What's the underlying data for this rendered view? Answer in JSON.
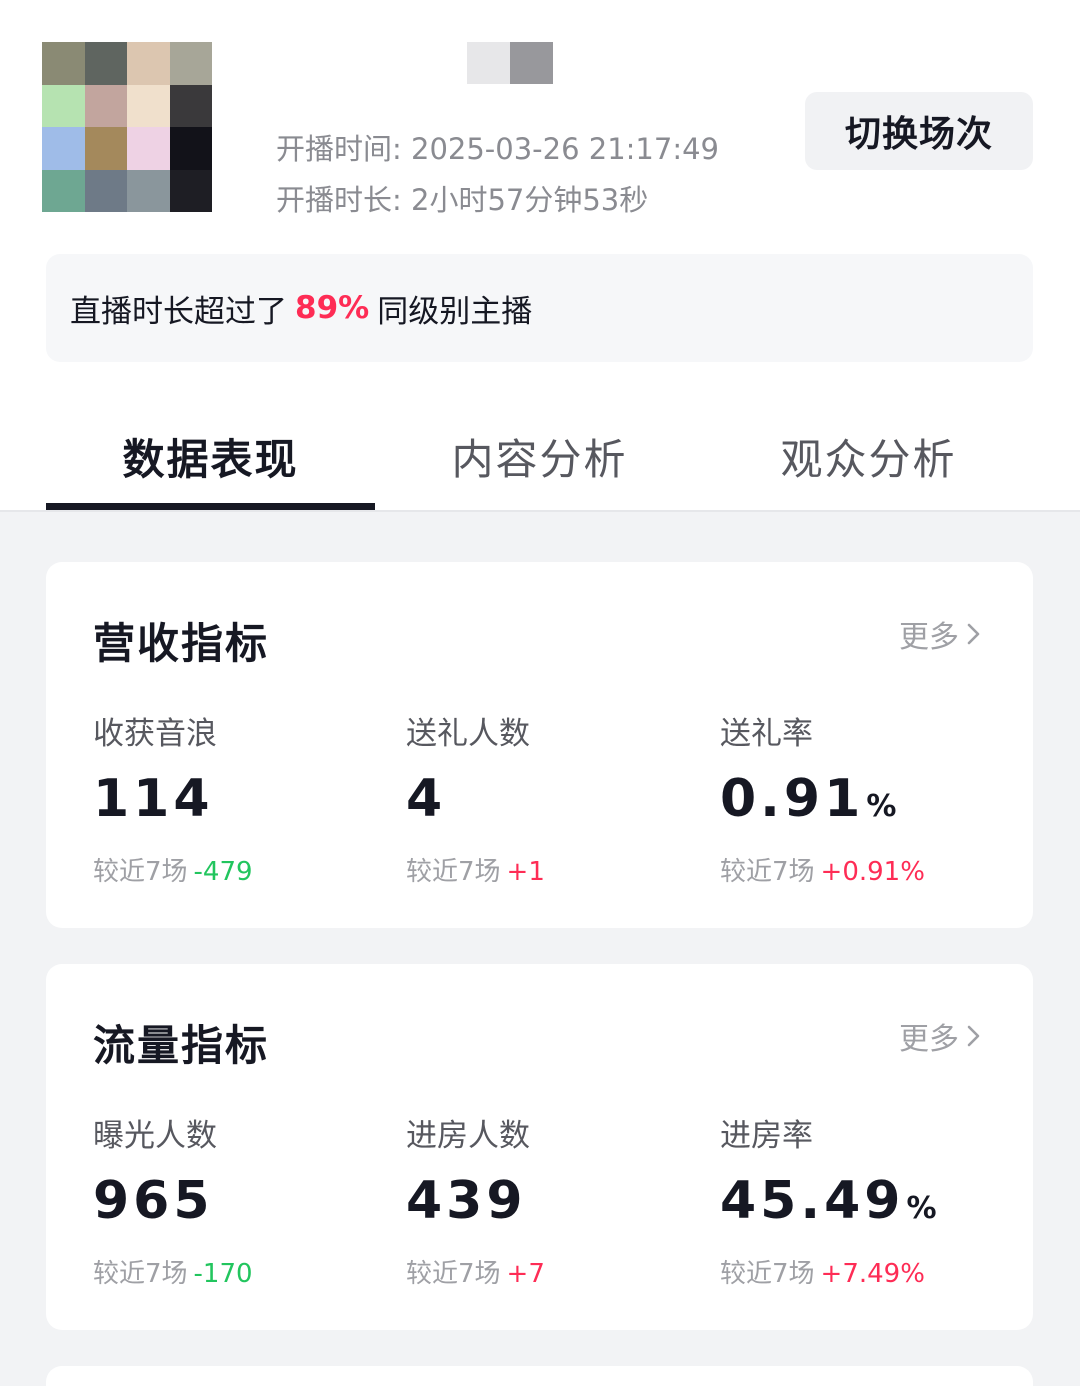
{
  "avatar": {
    "mosaic_colors": [
      "#8a8a74",
      "#5f6560",
      "#dcc6b0",
      "#a7a698",
      "#b6e3b1",
      "#c2a59e",
      "#f0e0cc",
      "#3a393b",
      "#9fbce8",
      "#a4895c",
      "#eed2e4",
      "#121219",
      "#6ea792",
      "#6e7a87",
      "#8a969c",
      "#1e1e24"
    ]
  },
  "name_mosaic_colors": [
    "#e7e7e9",
    "#98989c"
  ],
  "session": {
    "start_label": "开播时间:",
    "start_value": "2025-03-26 21:17:49",
    "duration_label": "开播时长:",
    "duration_value": "2小时57分钟53秒"
  },
  "switch_button_label": "切换场次",
  "tip": {
    "prefix": "直播时长超过了",
    "highlight": "89%",
    "suffix": "同级别主播"
  },
  "tabs": [
    {
      "label": "数据表现",
      "active": true
    },
    {
      "label": "内容分析",
      "active": false
    },
    {
      "label": "观众分析",
      "active": false
    }
  ],
  "cards": [
    {
      "title": "营收指标",
      "more_label": "更多",
      "metrics": [
        {
          "label": "收获音浪",
          "value": "114",
          "unit": "",
          "compare_label": "较近7场",
          "delta": "-479",
          "trend": "down"
        },
        {
          "label": "送礼人数",
          "value": "4",
          "unit": "",
          "compare_label": "较近7场",
          "delta": "+1",
          "trend": "up"
        },
        {
          "label": "送礼率",
          "value": "0.91",
          "unit": "%",
          "compare_label": "较近7场",
          "delta": "+0.91%",
          "trend": "up"
        }
      ]
    },
    {
      "title": "流量指标",
      "more_label": "更多",
      "metrics": [
        {
          "label": "曝光人数",
          "value": "965",
          "unit": "",
          "compare_label": "较近7场",
          "delta": "-170",
          "trend": "down"
        },
        {
          "label": "进房人数",
          "value": "439",
          "unit": "",
          "compare_label": "较近7场",
          "delta": "+7",
          "trend": "up"
        },
        {
          "label": "进房率",
          "value": "45.49",
          "unit": "%",
          "compare_label": "较近7场",
          "delta": "+7.49%",
          "trend": "up"
        }
      ]
    }
  ],
  "colors": {
    "accent_red": "#fe2c55",
    "down_green": "#22c55e",
    "text_primary": "#161823",
    "text_secondary": "#8a8b91"
  }
}
